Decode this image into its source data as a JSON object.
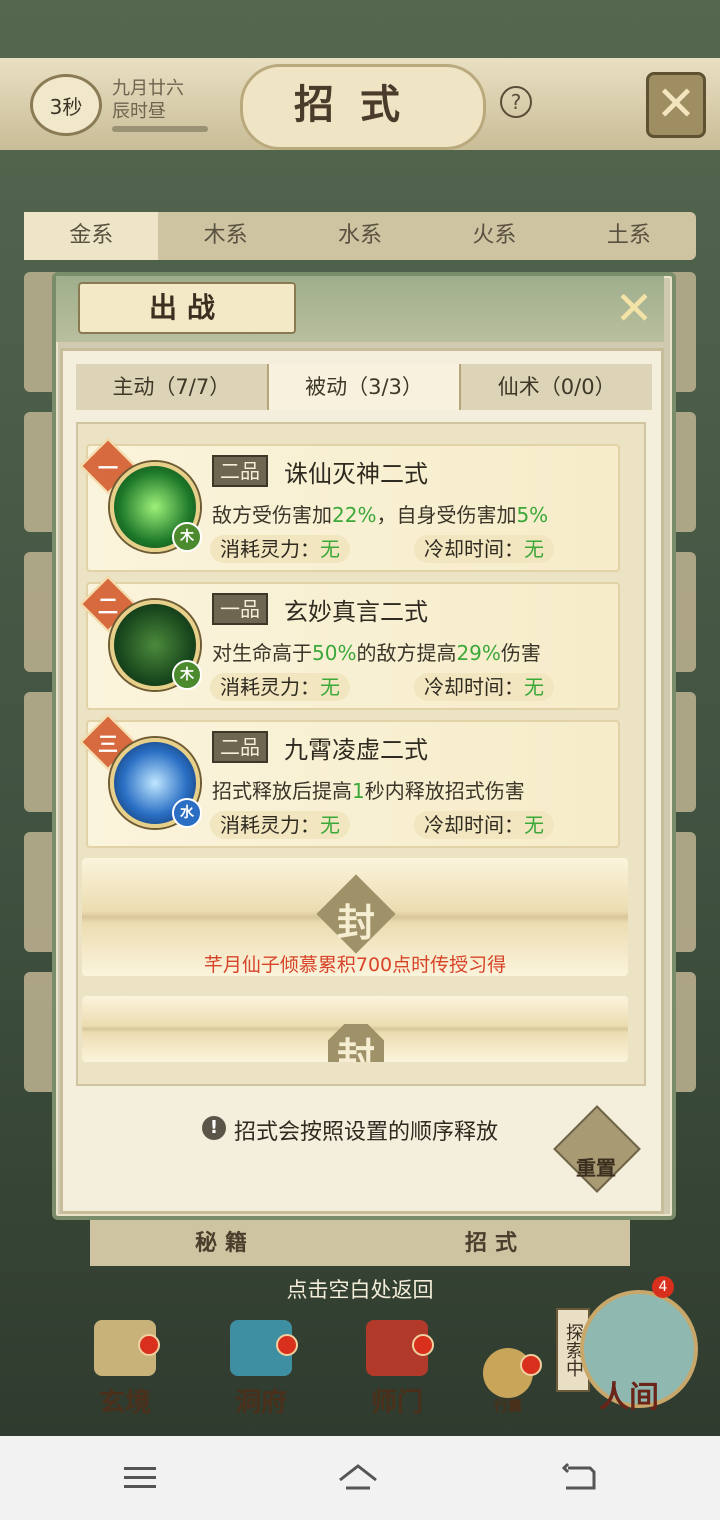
{
  "top_bar": {
    "timer": "3秒",
    "date_line1": "九月廿六",
    "date_line2": "辰时昼",
    "title": "招式",
    "help_icon": "?",
    "close_icon": "✕"
  },
  "element_tabs": [
    "金系",
    "木系",
    "水系",
    "火系",
    "土系"
  ],
  "modal": {
    "title": "出战",
    "close_icon": "✕",
    "type_tabs": [
      "主动（7/7）",
      "被动（3/3）",
      "仙术（0/0）"
    ],
    "skills": [
      {
        "rank": "一",
        "grade": "二品",
        "name": "诛仙灭神二式",
        "element": "木",
        "desc_parts": [
          "敌方受伤害加",
          "22%",
          "，自身受伤害加",
          "5%"
        ],
        "cost_label": "消耗灵力：",
        "cost_value": "无",
        "cooldown_label": "冷却时间：",
        "cooldown_value": "无"
      },
      {
        "rank": "二",
        "grade": "一品",
        "name": "玄妙真言二式",
        "element": "木",
        "desc_parts": [
          "对生命高于",
          "50%",
          "的敌方提高",
          "29%",
          "伤害"
        ],
        "cost_label": "消耗灵力：",
        "cost_value": "无",
        "cooldown_label": "冷却时间：",
        "cooldown_value": "无"
      },
      {
        "rank": "三",
        "grade": "二品",
        "name": "九霄凌虚二式",
        "element": "水",
        "desc_parts": [
          "招式释放后提高",
          "1",
          "秒内释放招式伤害"
        ],
        "cost_label": "消耗灵力：",
        "cost_value": "无",
        "cooldown_label": "冷却时间：",
        "cooldown_value": "无"
      }
    ],
    "locked_seal": "封",
    "unlock_hint": "芊月仙子倾慕累积700点时传授习得",
    "order_hint": "招式会按照设置的顺序释放",
    "reset_label": "重置"
  },
  "bottom_tabs": [
    "秘籍",
    "招式"
  ],
  "return_hint": "点击空白处返回",
  "nav": {
    "items": [
      "玄境",
      "洞府",
      "师门",
      "行囊"
    ],
    "explore_label": "探索中",
    "world_label": "人间",
    "badge_count": "4"
  },
  "colors": {
    "accent_green": "#3ca83a",
    "rank_orange": "#d86a3f",
    "warning_red": "#d8442a"
  }
}
